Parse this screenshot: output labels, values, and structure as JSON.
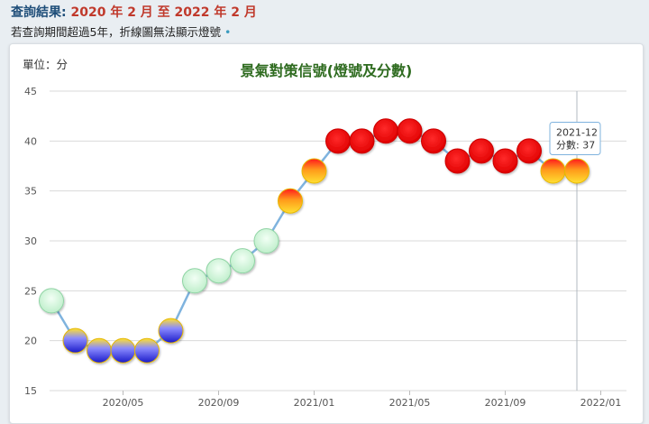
{
  "header": {
    "result_label": "查詢結果:",
    "result_range": "2020 年 2 月 至 2022 年 2 月",
    "note": "若查詢期間超過5年，折線圖無法顯示燈號",
    "note_dot": "•"
  },
  "chart_data": {
    "type": "line",
    "title": "景氣對策信號(燈號及分數)",
    "unit_label": "單位：分",
    "ylabel": "分",
    "ylim": [
      15,
      45
    ],
    "yticks": [
      15,
      20,
      25,
      30,
      35,
      40,
      45
    ],
    "xticks": [
      "2020/05",
      "2020/09",
      "2021/01",
      "2021/05",
      "2021/09",
      "2022/01"
    ],
    "x": [
      "2020-02",
      "2020-03",
      "2020-04",
      "2020-05",
      "2020-06",
      "2020-07",
      "2020-08",
      "2020-09",
      "2020-10",
      "2020-11",
      "2020-12",
      "2021-01",
      "2021-02",
      "2021-03",
      "2021-04",
      "2021-05",
      "2021-06",
      "2021-07",
      "2021-08",
      "2021-09",
      "2021-10",
      "2021-11",
      "2021-12"
    ],
    "values": [
      24,
      20,
      19,
      19,
      19,
      21,
      26,
      27,
      28,
      30,
      34,
      37,
      40,
      40,
      41,
      41,
      40,
      38,
      39,
      38,
      39,
      37,
      37
    ],
    "signals": [
      "green",
      "blue-yellow",
      "blue-yellow",
      "blue-yellow",
      "blue-yellow",
      "blue-yellow",
      "green",
      "green",
      "green",
      "green",
      "yellow-red",
      "yellow-red",
      "red",
      "red",
      "red",
      "red",
      "red",
      "red",
      "red",
      "red",
      "red",
      "yellow-red",
      "yellow-red"
    ],
    "grid": true,
    "tooltip": {
      "month": "2021-12",
      "label": "分數",
      "value": "37"
    },
    "colors": {
      "line": "#7fb3de",
      "green": "#ccf2d6",
      "blue": "#1a1ac8",
      "yellow": "#ffe033",
      "red": "#ff1a1a",
      "orange": "#ff8c00",
      "crosshair": "#b0b8c0"
    }
  }
}
